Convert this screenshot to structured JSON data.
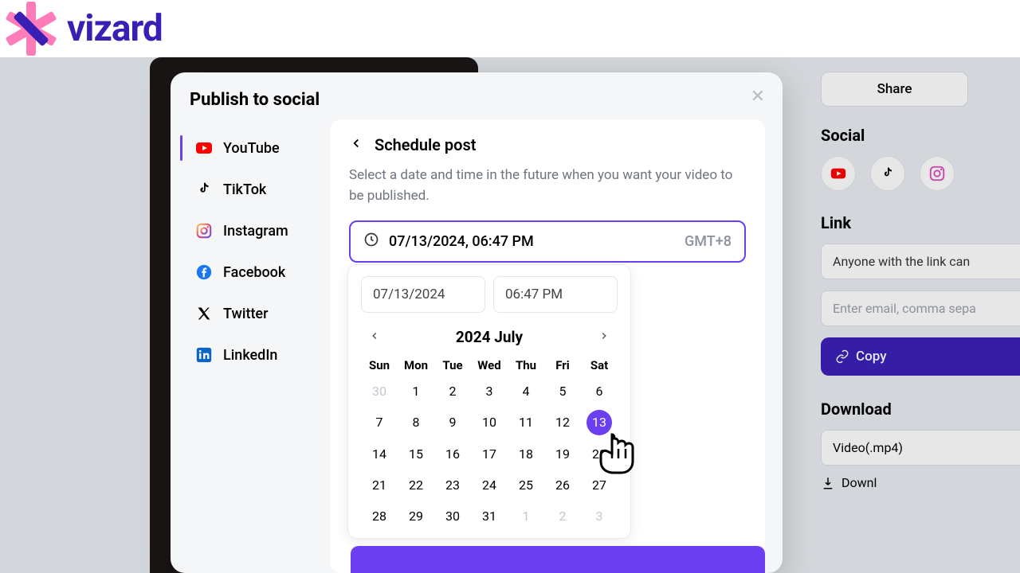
{
  "brand": {
    "name": "vizard"
  },
  "header": {
    "share": "Share"
  },
  "right": {
    "social_head": "Social",
    "link_head": "Link",
    "link_visibility": "Anyone with the link can",
    "email_placeholder": "Enter email, comma sepa",
    "copy": "Copy",
    "download_head": "Download",
    "video_label": "Video(.mp4)",
    "download_label": "Downl"
  },
  "modal": {
    "title": "Publish to social",
    "tabs": [
      "YouTube",
      "TikTok",
      "Instagram",
      "Facebook",
      "Twitter",
      "LinkedIn"
    ],
    "schedule_title": "Schedule post",
    "schedule_desc": "Select a date and time in the future when you want your video to be published.",
    "datetime": "07/13/2024, 06:47 PM",
    "tz": "GMT+8",
    "date_input": "07/13/2024",
    "time_input": "06:47 PM",
    "month_label": "2024 July",
    "dow": [
      "Sun",
      "Mon",
      "Tue",
      "Wed",
      "Thu",
      "Fri",
      "Sat"
    ],
    "days": [
      {
        "n": "30",
        "mute": true
      },
      {
        "n": "1"
      },
      {
        "n": "2"
      },
      {
        "n": "3"
      },
      {
        "n": "4"
      },
      {
        "n": "5"
      },
      {
        "n": "6"
      },
      {
        "n": "7"
      },
      {
        "n": "8"
      },
      {
        "n": "9"
      },
      {
        "n": "10"
      },
      {
        "n": "11"
      },
      {
        "n": "12"
      },
      {
        "n": "13",
        "sel": true
      },
      {
        "n": "14"
      },
      {
        "n": "15"
      },
      {
        "n": "16"
      },
      {
        "n": "17"
      },
      {
        "n": "18"
      },
      {
        "n": "19"
      },
      {
        "n": "20"
      },
      {
        "n": "21"
      },
      {
        "n": "22"
      },
      {
        "n": "23"
      },
      {
        "n": "24"
      },
      {
        "n": "25"
      },
      {
        "n": "26"
      },
      {
        "n": "27"
      },
      {
        "n": "28"
      },
      {
        "n": "29"
      },
      {
        "n": "30"
      },
      {
        "n": "31"
      },
      {
        "n": "1",
        "mute": true
      },
      {
        "n": "2",
        "mute": true
      },
      {
        "n": "3",
        "mute": true
      }
    ]
  }
}
